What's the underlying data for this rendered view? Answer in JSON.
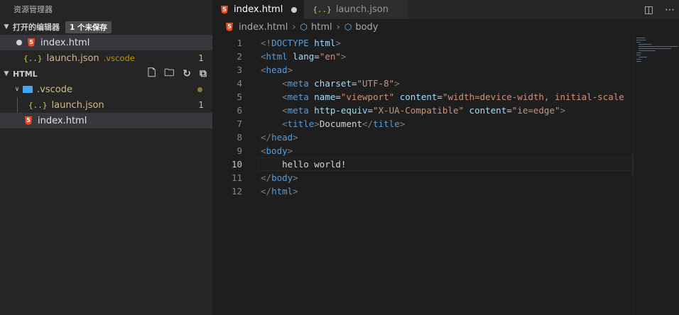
{
  "sidebar": {
    "title": "资源管理器",
    "open_editors": {
      "label": "打开的编辑器",
      "badge": "1 个未保存",
      "items": [
        {
          "name": "index.html",
          "icon": "html5-icon"
        },
        {
          "name": "launch.json",
          "desc": ".vscode",
          "count": "1",
          "icon": "json-icon"
        }
      ]
    },
    "folder": {
      "label": "HTML",
      "vscode": ".vscode",
      "launch": "launch.json",
      "launch_count": "1",
      "index": "index.html"
    }
  },
  "tabs": [
    {
      "label": "index.html"
    },
    {
      "label": "launch.json"
    }
  ],
  "breadcrumb": {
    "file": "index.html",
    "html": "html",
    "body": "body"
  },
  "colors": {
    "accent": "#37373d",
    "html": "#e44d26",
    "json": "#cbcb41"
  }
}
